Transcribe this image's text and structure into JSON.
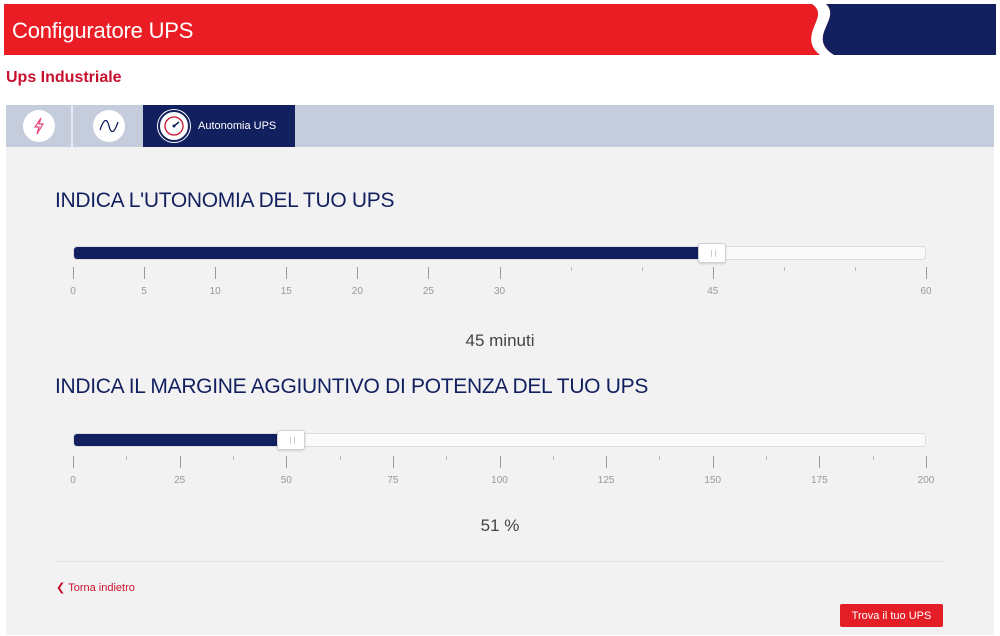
{
  "header": {
    "title": "Configuratore UPS",
    "brand_red": "#ea1d25",
    "brand_blue": "#13205f"
  },
  "page": {
    "subtitle": "Ups Industriale"
  },
  "tabs": [
    {
      "icon": "lightning-icon",
      "label": ""
    },
    {
      "icon": "sine-wave-icon",
      "label": ""
    },
    {
      "icon": "gauge-icon",
      "label": "Autonomia UPS",
      "active": true
    }
  ],
  "autonomy": {
    "title": "INDICA L'UTONOMIA DEL TUO UPS",
    "min": 0,
    "max": 60,
    "value": 45,
    "tick_labels": [
      "0",
      "5",
      "10",
      "15",
      "20",
      "25",
      "30",
      "45",
      "60"
    ],
    "tick_values": [
      0,
      5,
      10,
      15,
      20,
      25,
      30,
      35,
      40,
      45,
      50,
      55,
      60
    ],
    "value_text": "45 minuti"
  },
  "margin": {
    "title": "INDICA IL MARGINE AGGIUNTIVO DI POTENZA DEL TUO UPS",
    "min": 0,
    "max": 200,
    "value": 51,
    "tick_labels": [
      "0",
      "25",
      "50",
      "75",
      "100",
      "125",
      "150",
      "175",
      "200"
    ],
    "value_text": "51 %"
  },
  "footer": {
    "back_label": "Torna indietro",
    "find_label": "Trova il tuo UPS"
  }
}
